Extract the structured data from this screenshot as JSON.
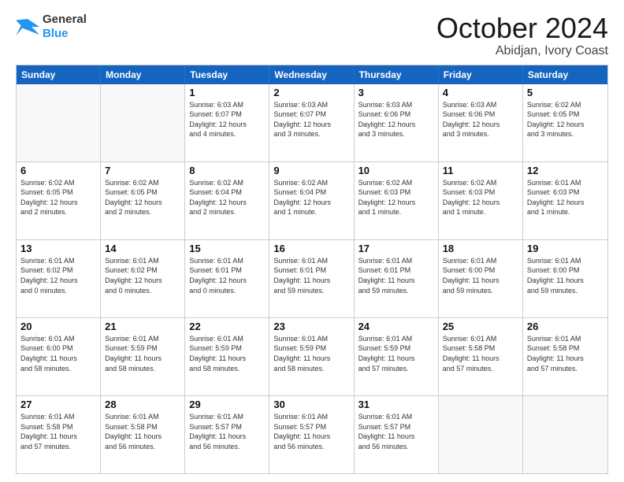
{
  "logo": {
    "text_general": "General",
    "text_blue": "Blue"
  },
  "header": {
    "month": "October 2024",
    "location": "Abidjan, Ivory Coast"
  },
  "days": [
    "Sunday",
    "Monday",
    "Tuesday",
    "Wednesday",
    "Thursday",
    "Friday",
    "Saturday"
  ],
  "weeks": [
    [
      {
        "day": "",
        "info": ""
      },
      {
        "day": "",
        "info": ""
      },
      {
        "day": "1",
        "info": "Sunrise: 6:03 AM\nSunset: 6:07 PM\nDaylight: 12 hours\nand 4 minutes."
      },
      {
        "day": "2",
        "info": "Sunrise: 6:03 AM\nSunset: 6:07 PM\nDaylight: 12 hours\nand 3 minutes."
      },
      {
        "day": "3",
        "info": "Sunrise: 6:03 AM\nSunset: 6:06 PM\nDaylight: 12 hours\nand 3 minutes."
      },
      {
        "day": "4",
        "info": "Sunrise: 6:03 AM\nSunset: 6:06 PM\nDaylight: 12 hours\nand 3 minutes."
      },
      {
        "day": "5",
        "info": "Sunrise: 6:02 AM\nSunset: 6:05 PM\nDaylight: 12 hours\nand 3 minutes."
      }
    ],
    [
      {
        "day": "6",
        "info": "Sunrise: 6:02 AM\nSunset: 6:05 PM\nDaylight: 12 hours\nand 2 minutes."
      },
      {
        "day": "7",
        "info": "Sunrise: 6:02 AM\nSunset: 6:05 PM\nDaylight: 12 hours\nand 2 minutes."
      },
      {
        "day": "8",
        "info": "Sunrise: 6:02 AM\nSunset: 6:04 PM\nDaylight: 12 hours\nand 2 minutes."
      },
      {
        "day": "9",
        "info": "Sunrise: 6:02 AM\nSunset: 6:04 PM\nDaylight: 12 hours\nand 1 minute."
      },
      {
        "day": "10",
        "info": "Sunrise: 6:02 AM\nSunset: 6:03 PM\nDaylight: 12 hours\nand 1 minute."
      },
      {
        "day": "11",
        "info": "Sunrise: 6:02 AM\nSunset: 6:03 PM\nDaylight: 12 hours\nand 1 minute."
      },
      {
        "day": "12",
        "info": "Sunrise: 6:01 AM\nSunset: 6:03 PM\nDaylight: 12 hours\nand 1 minute."
      }
    ],
    [
      {
        "day": "13",
        "info": "Sunrise: 6:01 AM\nSunset: 6:02 PM\nDaylight: 12 hours\nand 0 minutes."
      },
      {
        "day": "14",
        "info": "Sunrise: 6:01 AM\nSunset: 6:02 PM\nDaylight: 12 hours\nand 0 minutes."
      },
      {
        "day": "15",
        "info": "Sunrise: 6:01 AM\nSunset: 6:01 PM\nDaylight: 12 hours\nand 0 minutes."
      },
      {
        "day": "16",
        "info": "Sunrise: 6:01 AM\nSunset: 6:01 PM\nDaylight: 11 hours\nand 59 minutes."
      },
      {
        "day": "17",
        "info": "Sunrise: 6:01 AM\nSunset: 6:01 PM\nDaylight: 11 hours\nand 59 minutes."
      },
      {
        "day": "18",
        "info": "Sunrise: 6:01 AM\nSunset: 6:00 PM\nDaylight: 11 hours\nand 59 minutes."
      },
      {
        "day": "19",
        "info": "Sunrise: 6:01 AM\nSunset: 6:00 PM\nDaylight: 11 hours\nand 59 minutes."
      }
    ],
    [
      {
        "day": "20",
        "info": "Sunrise: 6:01 AM\nSunset: 6:00 PM\nDaylight: 11 hours\nand 58 minutes."
      },
      {
        "day": "21",
        "info": "Sunrise: 6:01 AM\nSunset: 5:59 PM\nDaylight: 11 hours\nand 58 minutes."
      },
      {
        "day": "22",
        "info": "Sunrise: 6:01 AM\nSunset: 5:59 PM\nDaylight: 11 hours\nand 58 minutes."
      },
      {
        "day": "23",
        "info": "Sunrise: 6:01 AM\nSunset: 5:59 PM\nDaylight: 11 hours\nand 58 minutes."
      },
      {
        "day": "24",
        "info": "Sunrise: 6:01 AM\nSunset: 5:59 PM\nDaylight: 11 hours\nand 57 minutes."
      },
      {
        "day": "25",
        "info": "Sunrise: 6:01 AM\nSunset: 5:58 PM\nDaylight: 11 hours\nand 57 minutes."
      },
      {
        "day": "26",
        "info": "Sunrise: 6:01 AM\nSunset: 5:58 PM\nDaylight: 11 hours\nand 57 minutes."
      }
    ],
    [
      {
        "day": "27",
        "info": "Sunrise: 6:01 AM\nSunset: 5:58 PM\nDaylight: 11 hours\nand 57 minutes."
      },
      {
        "day": "28",
        "info": "Sunrise: 6:01 AM\nSunset: 5:58 PM\nDaylight: 11 hours\nand 56 minutes."
      },
      {
        "day": "29",
        "info": "Sunrise: 6:01 AM\nSunset: 5:57 PM\nDaylight: 11 hours\nand 56 minutes."
      },
      {
        "day": "30",
        "info": "Sunrise: 6:01 AM\nSunset: 5:57 PM\nDaylight: 11 hours\nand 56 minutes."
      },
      {
        "day": "31",
        "info": "Sunrise: 6:01 AM\nSunset: 5:57 PM\nDaylight: 11 hours\nand 56 minutes."
      },
      {
        "day": "",
        "info": ""
      },
      {
        "day": "",
        "info": ""
      }
    ]
  ]
}
